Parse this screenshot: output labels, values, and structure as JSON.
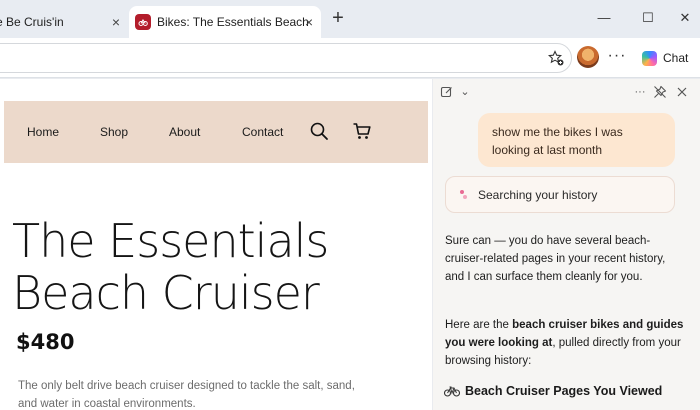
{
  "tabs": [
    {
      "title": "e Be Cruis'in",
      "active": false
    },
    {
      "title": "Bikes: The Essentials Beach Cruiser",
      "active": true
    }
  ],
  "tab_close_glyph": "×",
  "new_tab_glyph": "+",
  "window_controls": {
    "minimize": "—",
    "maximize": "☐",
    "close": "✕"
  },
  "toolbar": {
    "more_glyph": "···",
    "chat_label": "Chat"
  },
  "site": {
    "nav": [
      "Home",
      "Shop",
      "About",
      "Contact"
    ],
    "product_title": "The Essentials Beach Cruiser",
    "price": "$480",
    "description": "The only belt drive beach cruiser designed to tackle the salt, sand, and water in coastal environments."
  },
  "copilot": {
    "header_icons": {
      "chevron": "⌄",
      "more": "···"
    },
    "user_message": "show me the bikes I was looking at last month",
    "status": "Searching your history",
    "response_1": "Sure can — you do have several beach-cruiser-related pages in your recent history, and I can surface them cleanly for you.",
    "response_2": {
      "part1": "Here are the ",
      "bold": "beach cruiser bikes and guides you were looking at",
      "part2": ", pulled directly from your browsing history:"
    },
    "heading": "Beach Cruiser Pages You Viewed"
  },
  "colors": {
    "nav_band": "#ecd9cb",
    "user_bubble": "#fde7d1",
    "favicon": "#b31d2b"
  }
}
